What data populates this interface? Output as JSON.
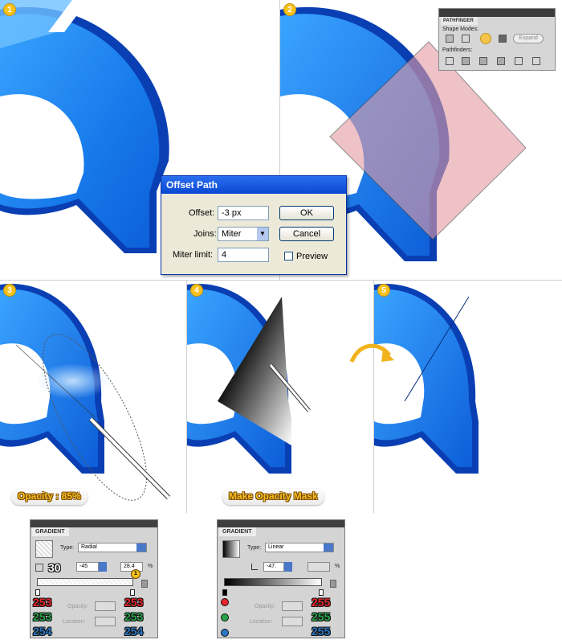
{
  "steps": [
    "1",
    "2",
    "3",
    "4",
    "5"
  ],
  "offset_dialog": {
    "title": "Offset Path",
    "offset_label": "Offset:",
    "offset_value": "-3 px",
    "joins_label": "Joins:",
    "joins_value": "Miter",
    "miter_label": "Miter limit:",
    "miter_value": "4",
    "ok_label": "OK",
    "cancel_label": "Cancel",
    "preview_label": "Preview"
  },
  "pathfinder": {
    "tab": "PATHFINDER",
    "shape_modes_label": "Shape Modes:",
    "expand_label": "Expand",
    "pathfinders_label": "Pathfinders:"
  },
  "labels": {
    "opacity": "Opacity : 85%",
    "mask": "Make Opacity Mask"
  },
  "gradient_left": {
    "tab": "GRADIENT",
    "type_label": "Type:",
    "type_value": "Radial",
    "angle_badge": "30",
    "angle_value": "-45",
    "aspect_value": "28.4",
    "percent": "%",
    "opacity_label": "Opacity:",
    "location_label": "Location:",
    "marker": "1",
    "left_r": "253",
    "left_g": "253",
    "left_b": "254",
    "right_r": "253",
    "right_g": "253",
    "right_b": "254"
  },
  "gradient_right": {
    "tab": "GRADIENT",
    "type_label": "Type:",
    "type_value": "Linear",
    "angle_value": "-47.",
    "percent": "%",
    "opacity_label": "Opacity:",
    "location_label": "Location:",
    "right_r": "255",
    "right_g": "255",
    "right_b": "255"
  },
  "colors": {
    "blue_primary": "#1a84f0",
    "blue_dark": "#0a3fb3",
    "pink": "#eab3b8",
    "accent_yellow": "#f7c21b"
  }
}
